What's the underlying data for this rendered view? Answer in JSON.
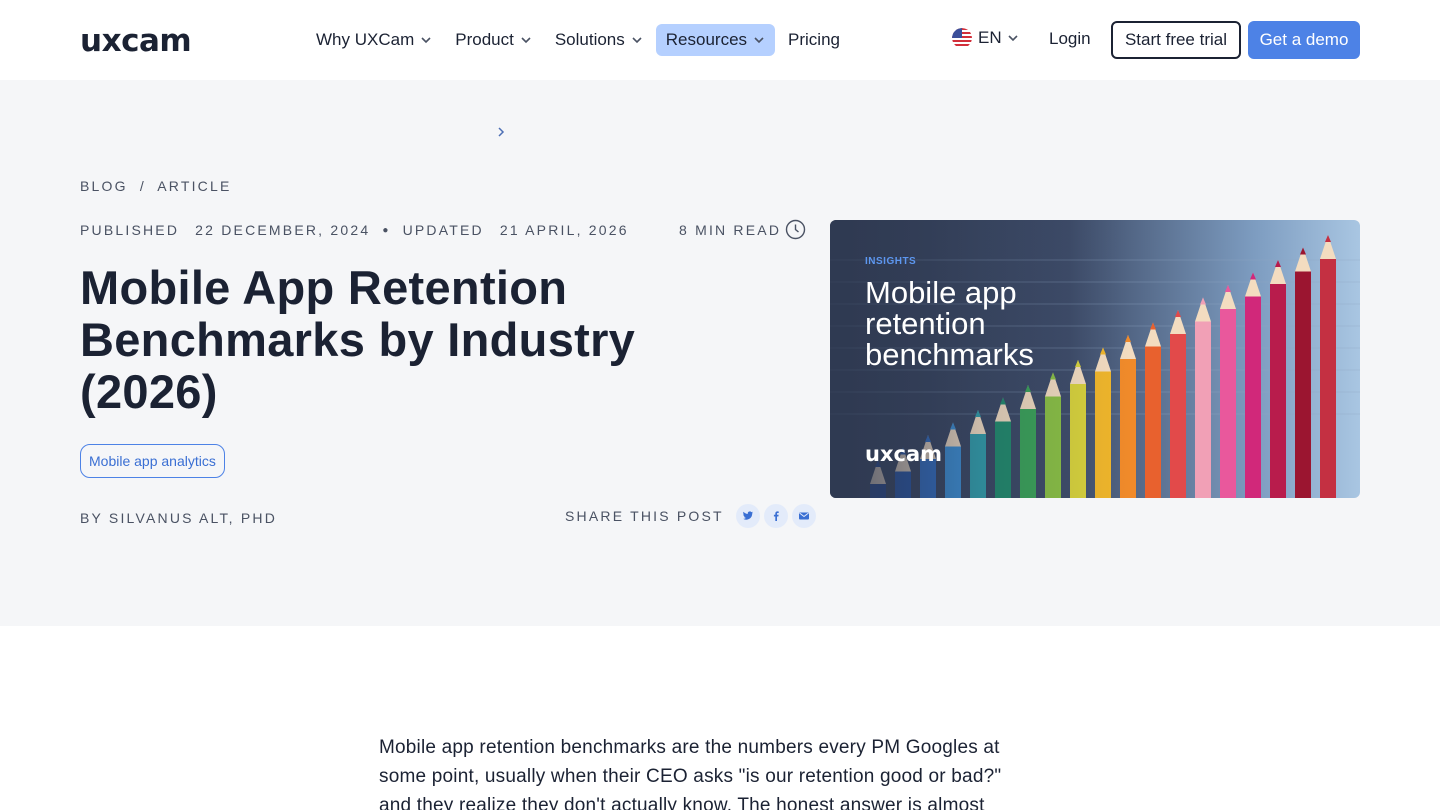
{
  "header": {
    "logo_text": "uxcam",
    "nav": [
      {
        "label": "Why UXCam",
        "has_dropdown": true,
        "active": false
      },
      {
        "label": "Product",
        "has_dropdown": true,
        "active": false
      },
      {
        "label": "Solutions",
        "has_dropdown": true,
        "active": false
      },
      {
        "label": "Resources",
        "has_dropdown": true,
        "active": true
      },
      {
        "label": "Pricing",
        "has_dropdown": false,
        "active": false
      }
    ],
    "language": "EN",
    "login": "Login",
    "start_trial": "Start free trial",
    "get_demo": "Get a demo"
  },
  "hero": {
    "breadcrumb": {
      "blog": "BLOG",
      "separator": "/",
      "article": "ARTICLE"
    },
    "published_label": "PUBLISHED",
    "published_date": "22 DECEMBER, 2024",
    "updated_label": "UPDATED",
    "updated_date": "21 APRIL, 2026",
    "read_time": "8 MIN READ",
    "title": "Mobile App Retention Benchmarks by Industry (2026)",
    "tag": "Mobile app analytics",
    "author": "BY SILVANUS ALT, PHD",
    "share_label": "SHARE THIS POST",
    "image": {
      "kicker": "INSIGHTS",
      "title_lines": [
        "Mobile app",
        "retention",
        "benchmarks"
      ],
      "logo_text": "uxcam"
    }
  },
  "body": {
    "intro": "Mobile app retention benchmarks are the numbers every PM Googles at some point, usually when their CEO asks \"is our retention good or bad?\" and they realize they don't actually know. The honest answer is almost"
  },
  "colors": {
    "accent": "#4d82e6",
    "active_nav_bg": "#b5d0ff",
    "hero_bg": "#f5f6f8",
    "text": "#1b2233",
    "muted": "#4a5263"
  }
}
